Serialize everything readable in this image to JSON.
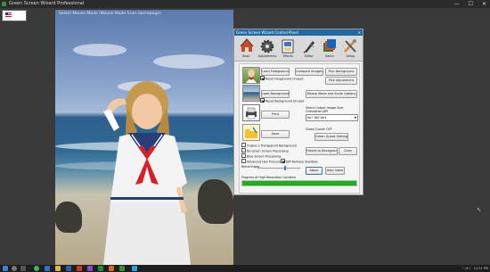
{
  "window": {
    "title": "Green Screen Wizard Professional",
    "controls": [
      "—",
      "☐",
      "✕"
    ]
  },
  "photo": {
    "caption": "Select Mouse Mode (Mouse Mode from Homepage)"
  },
  "panel": {
    "title": "Green Screen Wizard Control Panel",
    "tools": [
      {
        "label": "Basic",
        "icon": "house-icon"
      },
      {
        "label": "Adjustments",
        "icon": "gear-icon"
      },
      {
        "label": "Effects",
        "icon": "effects-icon"
      },
      {
        "label": "Editor",
        "icon": "paintbrush-icon"
      },
      {
        "label": "Batch",
        "icon": "batch-icon"
      },
      {
        "label": "Setup",
        "icon": "tools-icon"
      }
    ],
    "buttons": {
      "load_foreground": "Load Foreground",
      "compare_images": "Compare Images",
      "pick_background": "Pick Background",
      "pick_adjustment": "Pick Adjustment",
      "load_background": "Load Background",
      "mouse_move": "Mouse Move and Scale Options",
      "print": "Print",
      "save": "Save",
      "green_guard": "Green Guard Settings",
      "freeze_bg": "Freeze to Background",
      "clear": "Clear",
      "about": "About",
      "help_index": "Help Index"
    },
    "checks": {
      "reset_fg": "Reset Foreground Unused",
      "reset_bg": "Reset Background Unused",
      "transparent": "Output a Transparent Background",
      "no_green": "No Green Screen Processing",
      "blue": "Blue Screen Processing",
      "advanced_hair": "Advanced Hair Processing",
      "dp_remove": "D/P Remove Shadows"
    },
    "output": {
      "label": "Select Output Image Size, Orientation,DPI",
      "value": "8x7 300 Vert"
    },
    "guard_label": "Green Guard: OFF",
    "blend_label": "Blend Edges",
    "blend_value": 0.62,
    "progress_label": "Progress of High Resolution Combine",
    "progress": 1.0
  },
  "taskbar": {
    "clock": "12:21 PM",
    "date": ""
  },
  "colors": {
    "accent": "#1f6aa5",
    "progress": "#19b319"
  }
}
